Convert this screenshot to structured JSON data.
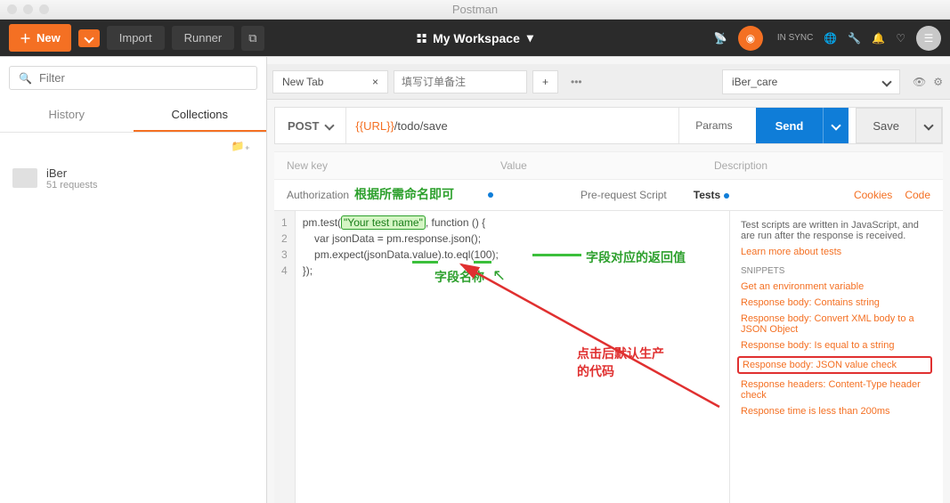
{
  "window": {
    "title": "Postman"
  },
  "toolbar": {
    "new": "New",
    "import": "Import",
    "runner": "Runner",
    "workspace": "My Workspace",
    "sync": "IN SYNC"
  },
  "sidebar": {
    "filter_placeholder": "Filter",
    "tabs": {
      "history": "History",
      "collections": "Collections"
    },
    "collection": {
      "name": "iBer",
      "sub": "51 requests"
    }
  },
  "tabs": {
    "active": "New Tab",
    "note_placeholder": "填写订单备注"
  },
  "env": {
    "selected": "iBer_care"
  },
  "request": {
    "method": "POST",
    "url_var": "{{URL}}",
    "url_path": "/todo/save",
    "params": "Params",
    "send": "Send",
    "save": "Save"
  },
  "headers_row": {
    "key": "New key",
    "value": "Value",
    "desc": "Description"
  },
  "subtabs": {
    "auth": "Authorization",
    "pre": "Pre-request Script",
    "tests": "Tests",
    "cookies": "Cookies",
    "code": "Code"
  },
  "editor": {
    "l1a": "pm.test(",
    "l1b": "\"Your test name\"",
    "l1c": ", function () {",
    "l2": "    var jsonData = pm.response.json();",
    "l3a": "    pm.expect(jsonData.",
    "l3b": "value",
    "l3c": ").to.eql(",
    "l3d": "100",
    "l3e": ");",
    "l4": "});"
  },
  "annotations": {
    "name_hint": "根据所需命名即可",
    "field_name": "字段名称",
    "field_value": "字段对应的返回值",
    "click_hint_1": "点击后默认生产",
    "click_hint_2": "的代码"
  },
  "snippets": {
    "desc": "Test scripts are written in JavaScript, and are run after the response is received.",
    "learn": "Learn more about tests",
    "header": "SNIPPETS",
    "items": [
      "Get an environment variable",
      "Response body: Contains string",
      "Response body: Convert XML body to a JSON Object",
      "Response body: Is equal to a string",
      "Response body: JSON value check",
      "Response headers: Content-Type header check",
      "Response time is less than 200ms"
    ]
  }
}
